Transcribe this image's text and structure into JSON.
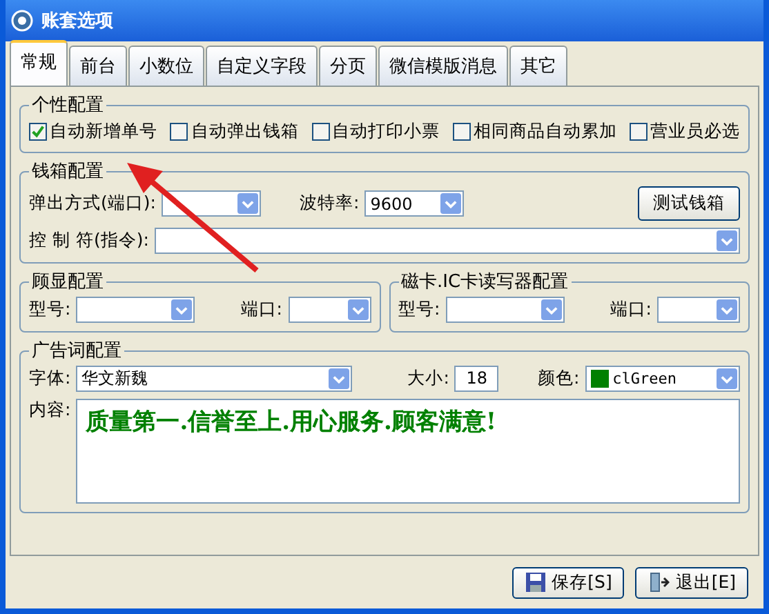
{
  "window": {
    "title": "账套选项"
  },
  "tabs": [
    {
      "label": "常规",
      "selected": true
    },
    {
      "label": "前台",
      "selected": false
    },
    {
      "label": "小数位",
      "selected": false
    },
    {
      "label": "自定义字段",
      "selected": false
    },
    {
      "label": "分页",
      "selected": false
    },
    {
      "label": "微信模版消息",
      "selected": false
    },
    {
      "label": "其它",
      "selected": false
    }
  ],
  "personal_config": {
    "title": "个性配置",
    "options": [
      {
        "label": "自动新增单号",
        "checked": true
      },
      {
        "label": "自动弹出钱箱",
        "checked": false
      },
      {
        "label": "自动打印小票",
        "checked": false
      },
      {
        "label": "相同商品自动累加",
        "checked": false
      },
      {
        "label": "营业员必选",
        "checked": false
      }
    ]
  },
  "cash_drawer": {
    "title": "钱箱配置",
    "port_label": "弹出方式(端口):",
    "baud_label": "波特率:",
    "baud_value": "9600",
    "test_button": "测试钱箱",
    "control_label": "控 制 符(指令):"
  },
  "customer_display": {
    "title": "顾显配置",
    "model_label": "型号:",
    "port_label": "端口:"
  },
  "card_reader": {
    "title": "磁卡.IC卡读写器配置",
    "model_label": "型号:",
    "port_label": "端口:"
  },
  "ad_config": {
    "title": "广告词配置",
    "font_label": "字体:",
    "font_value": "华文新魏",
    "size_label": "大小:",
    "size_value": "18",
    "color_label": "颜色:",
    "color_value": "clGreen",
    "color": "#008000",
    "content_label": "内容:",
    "content": "质量第一.信誉至上.用心服务.顾客满意!"
  },
  "buttons": [
    {
      "label": "保存[S]",
      "kind": "save"
    },
    {
      "label": "退出[E]",
      "kind": "exit"
    }
  ]
}
